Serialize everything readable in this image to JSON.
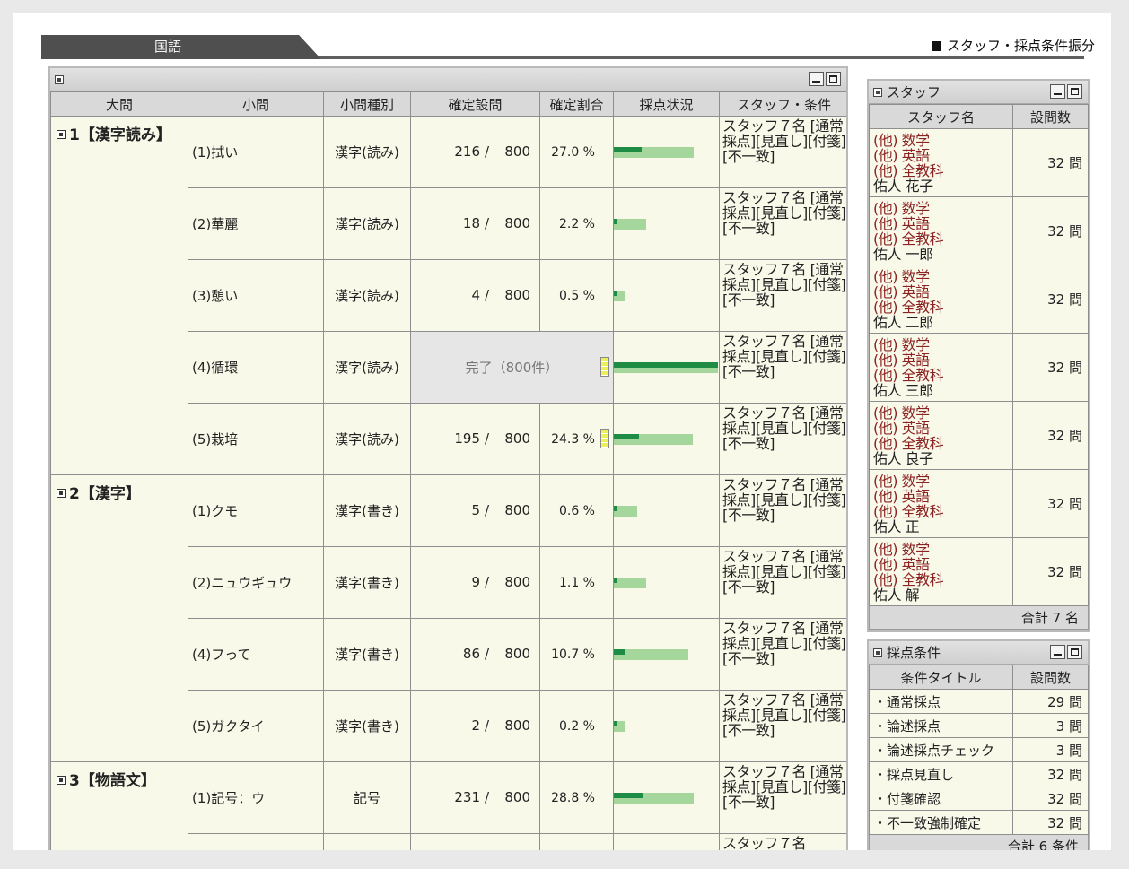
{
  "tab": {
    "label": "国語"
  },
  "staff_link": {
    "label": "スタッフ・採点条件振分"
  },
  "main": {
    "headers": [
      "大問",
      "小問",
      "小問種別",
      "確定設問",
      "確定割合",
      "採点状況",
      "スタッフ・条件"
    ],
    "groups": [
      {
        "label": "1【漢字読み】",
        "rows": [
          {
            "sub": "(1)拭い",
            "type": "漢字(読み)",
            "done": "216",
            "total": "800",
            "pct": "27.0 %",
            "fraction": 0.27,
            "complete": false,
            "flag": false,
            "cond": "スタッフ７名 [通常採点][見直し][付箋][不一致]"
          },
          {
            "sub": "(2)華麗",
            "type": "漢字(読み)",
            "done": "18",
            "total": "800",
            "pct": "2.2 %",
            "fraction": 0.022,
            "complete": false,
            "flag": false,
            "cond": "スタッフ７名 [通常採点][見直し][付箋][不一致]"
          },
          {
            "sub": "(3)憩い",
            "type": "漢字(読み)",
            "done": "4",
            "total": "800",
            "pct": "0.5 %",
            "fraction": 0.005,
            "complete": false,
            "flag": false,
            "cond": "スタッフ７名 [通常採点][見直し][付箋][不一致]"
          },
          {
            "sub": "(4)循環",
            "type": "漢字(読み)",
            "done": "",
            "total": "",
            "pct": "",
            "fraction": 1.0,
            "complete": true,
            "complete_text": "完了（800件）",
            "flag": true,
            "cond": "スタッフ７名 [通常採点][見直し][付箋][不一致]"
          },
          {
            "sub": "(5)栽培",
            "type": "漢字(読み)",
            "done": "195",
            "total": "800",
            "pct": "24.3 %",
            "fraction": 0.243,
            "complete": false,
            "flag": true,
            "cond": "スタッフ７名 [通常採点][見直し][付箋][不一致]"
          }
        ]
      },
      {
        "label": "2【漢字】",
        "rows": [
          {
            "sub": "(1)クモ",
            "type": "漢字(書き)",
            "done": "5",
            "total": "800",
            "pct": "0.6 %",
            "fraction": 0.006,
            "complete": false,
            "flag": false,
            "cond": "スタッフ７名 [通常採点][見直し][付箋][不一致]"
          },
          {
            "sub": "(2)ニュウギュウ",
            "type": "漢字(書き)",
            "done": "9",
            "total": "800",
            "pct": "1.1 %",
            "fraction": 0.011,
            "complete": false,
            "flag": false,
            "cond": "スタッフ７名 [通常採点][見直し][付箋][不一致]"
          },
          {
            "sub": "(4)フって",
            "type": "漢字(書き)",
            "done": "86",
            "total": "800",
            "pct": "10.7 %",
            "fraction": 0.107,
            "complete": false,
            "flag": false,
            "cond": "スタッフ７名 [通常採点][見直し][付箋][不一致]"
          },
          {
            "sub": "(5)ガクタイ",
            "type": "漢字(書き)",
            "done": "2",
            "total": "800",
            "pct": "0.2 %",
            "fraction": 0.002,
            "complete": false,
            "flag": false,
            "cond": "スタッフ７名 [通常採点][見直し][付箋][不一致]"
          }
        ]
      },
      {
        "label": "3【物語文】",
        "rows": [
          {
            "sub": "(1)記号：ウ",
            "type": "記号",
            "done": "231",
            "total": "800",
            "pct": "28.8 %",
            "fraction": 0.288,
            "complete": false,
            "flag": false,
            "cond": "スタッフ７名 [通常採点][見直し][付箋][不一致]"
          },
          {
            "sub": "",
            "type": "",
            "done": "",
            "total": "",
            "pct": "",
            "fraction": 0,
            "complete": false,
            "flag": false,
            "cond": "スタッフ７名"
          }
        ]
      }
    ]
  },
  "staff": {
    "title": "スタッフ",
    "headers": [
      "スタッフ名",
      "設問数"
    ],
    "roles": [
      "(他) 数学",
      "(他) 英語",
      "(他) 全教科"
    ],
    "rows": [
      {
        "name": "佑人 花子",
        "count": "32 問"
      },
      {
        "name": "佑人 一郎",
        "count": "32 問"
      },
      {
        "name": "佑人 二郎",
        "count": "32 問"
      },
      {
        "name": "佑人 三郎",
        "count": "32 問"
      },
      {
        "name": "佑人 良子",
        "count": "32 問"
      },
      {
        "name": "佑人 正",
        "count": "32 問"
      },
      {
        "name": "佑人 解",
        "count": "32 問"
      }
    ],
    "total": "合計 7 名"
  },
  "criteria": {
    "title": "採点条件",
    "headers": [
      "条件タイトル",
      "設問数"
    ],
    "rows": [
      {
        "title": "・通常採点",
        "count": "29 問"
      },
      {
        "title": "・論述採点",
        "count": "3 問"
      },
      {
        "title": "・論述採点チェック",
        "count": "3 問"
      },
      {
        "title": "・採点見直し",
        "count": "32 問"
      },
      {
        "title": "・付箋確認",
        "count": "32 問"
      },
      {
        "title": "・不一致強制確定",
        "count": "32 問"
      }
    ],
    "total": "合計 6 条件"
  },
  "colors": {
    "bar_fill": "#1e8c44",
    "bar_track": "#a5d79d",
    "role_text": "#8b2323",
    "cell_bg": "#f9f9ea"
  }
}
